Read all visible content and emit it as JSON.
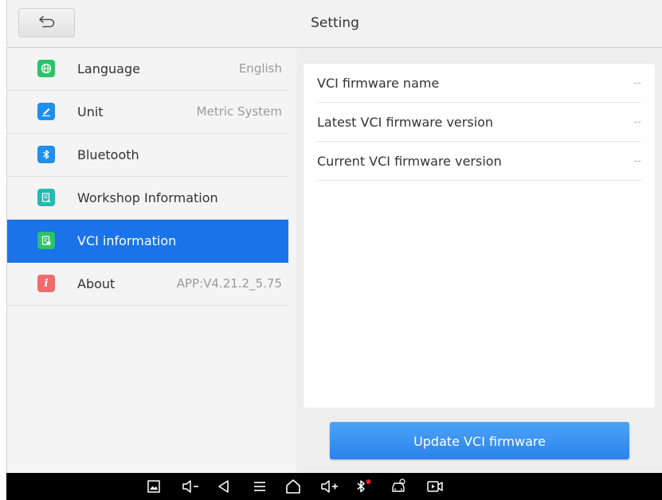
{
  "header": {
    "title": "Setting"
  },
  "sidebar": {
    "items": [
      {
        "label": "Language",
        "value": "English",
        "icon": "globe-icon",
        "color": "#2bc36b"
      },
      {
        "label": "Unit",
        "value": "Metric System",
        "icon": "pencil-icon",
        "color": "#1f8ff0"
      },
      {
        "label": "Bluetooth",
        "value": "",
        "icon": "bluetooth-icon",
        "color": "#1f8ff0"
      },
      {
        "label": "Workshop Information",
        "value": "",
        "icon": "document-icon",
        "color": "#25b9b3"
      },
      {
        "label": "VCI information",
        "value": "",
        "icon": "vci-icon",
        "color": "#2bc36b",
        "active": true
      },
      {
        "label": "About",
        "value": "APP:V4.21.2_5.75",
        "icon": "info-icon",
        "color": "#f06b6b"
      }
    ]
  },
  "panel": {
    "rows": [
      {
        "label": "VCI firmware name",
        "value": "--"
      },
      {
        "label": "Latest VCI firmware version",
        "value": "--"
      },
      {
        "label": "Current VCI firmware version",
        "value": "--"
      }
    ]
  },
  "actions": {
    "update_label": "Update VCI firmware"
  },
  "colors": {
    "accent": "#1a73e8",
    "button": "#3a90f0"
  }
}
